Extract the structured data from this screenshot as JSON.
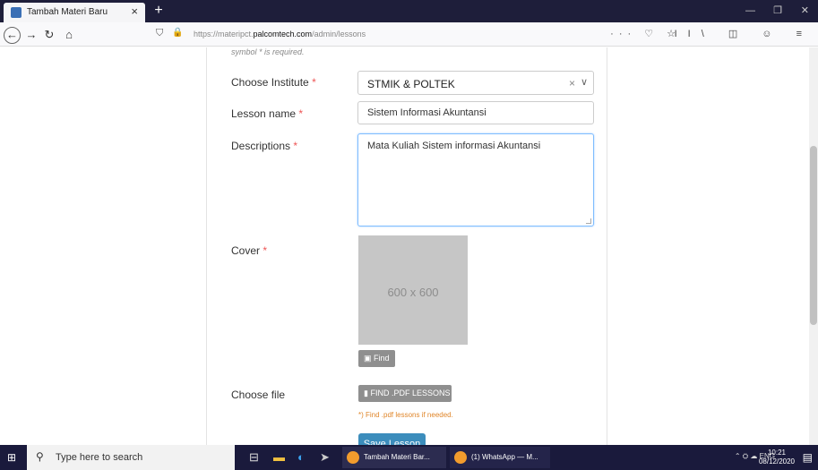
{
  "browser": {
    "tab_title": "Tambah Materi Baru",
    "tab_close": "×",
    "new_tab": "+",
    "url_prefix": "https://materipct.",
    "url_domain": "palcomtech.com",
    "url_path": "/admin/lessons",
    "url_actions": "··· ♡ ☆",
    "toolbar_icons": "II\\ ◫ ☺ ≡"
  },
  "form": {
    "required_note": "symbol * is required.",
    "institute_label": "Choose Institute",
    "institute_value": "STMIK & POLTEK",
    "lesson_label": "Lesson name",
    "lesson_value": "Sistem Informasi Akuntansi",
    "desc_label": "Descriptions",
    "desc_value": "Mata Kuliah Sistem informasi Akuntansi",
    "cover_label": "Cover",
    "cover_placeholder": "600 x 600",
    "find_button": "Find",
    "file_label": "Choose file",
    "pdf_button": "FIND .PDF LESSONS",
    "pdf_hint": "*) Find .pdf lessons if needed.",
    "save_button": "Save Lesson",
    "required_mark": "*"
  },
  "taskbar": {
    "search_placeholder": "Type here to search",
    "app1": "Tambah Materi Bar...",
    "app2": "(1) WhatsApp — M...",
    "tray_lang": "ENG",
    "time": "10:21",
    "date": "08/12/2020"
  },
  "colors": {
    "tabbar_bg": "#1e1e3a",
    "taskbar_bg": "#1a1a3c",
    "save_button": "#3c8dbc",
    "gray_button": "#8f8f8f",
    "hint_text": "#e0862a",
    "required": "#e55555"
  }
}
